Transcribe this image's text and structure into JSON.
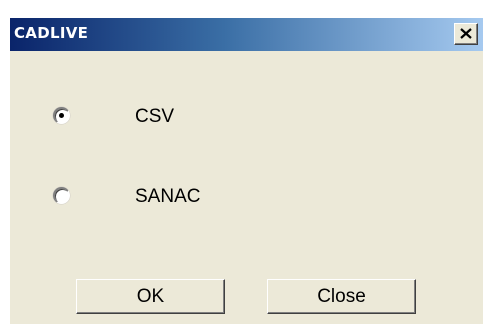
{
  "window": {
    "title": "CADLIVE",
    "close_icon": "close-x-icon"
  },
  "options": [
    {
      "label": "CSV",
      "selected": true
    },
    {
      "label": "SANAC",
      "selected": false
    }
  ],
  "buttons": {
    "ok_label": "OK",
    "close_label": "Close"
  },
  "colors": {
    "title_start": "#0a246a",
    "title_end": "#a6caf0",
    "dialog_bg": "#ece9d8"
  }
}
